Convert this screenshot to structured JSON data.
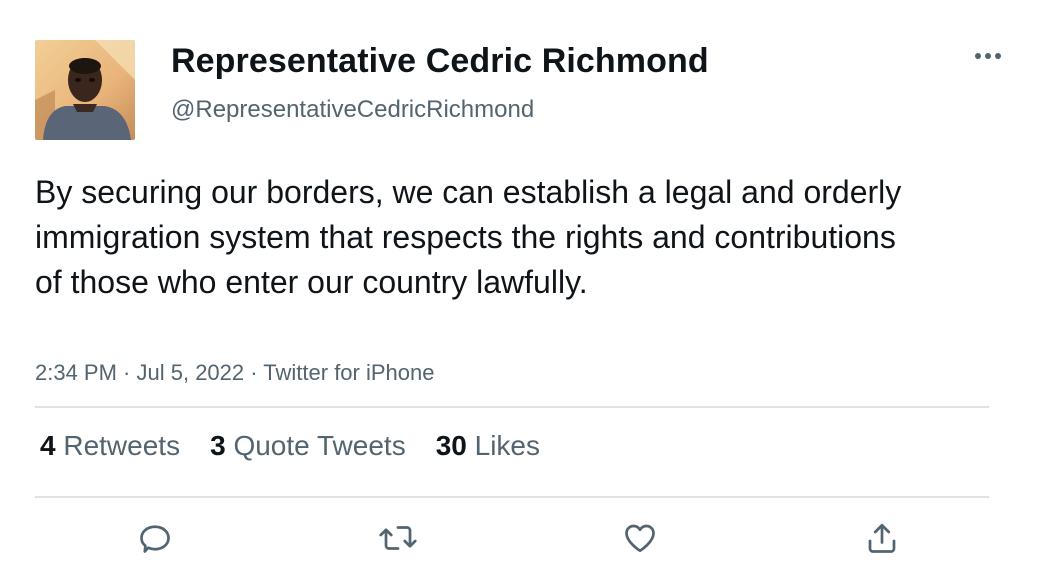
{
  "user": {
    "display_name": "Representative Cedric Richmond",
    "handle": "@RepresentativeCedricRichmond",
    "avatar": "profile-photo"
  },
  "tweet": {
    "text": "By securing our borders, we can establish a legal and orderly immigration system that respects the rights and contributions of those who enter our country lawfully.",
    "time": "2:34 PM",
    "date": "Jul 5, 2022",
    "source": "Twitter for iPhone",
    "separator": " · "
  },
  "stats": {
    "retweets_count": "4",
    "retweets_label": "Retweets",
    "quotes_count": "3",
    "quotes_label": "Quote Tweets",
    "likes_count": "30",
    "likes_label": "Likes"
  },
  "actions": {
    "reply_icon": "reply-icon",
    "retweet_icon": "retweet-icon",
    "like_icon": "heart-icon",
    "share_icon": "share-icon",
    "more_icon": "more-icon"
  },
  "colors": {
    "text": "#0f1419",
    "secondary": "#536471",
    "divider": "#dfe3e6"
  }
}
